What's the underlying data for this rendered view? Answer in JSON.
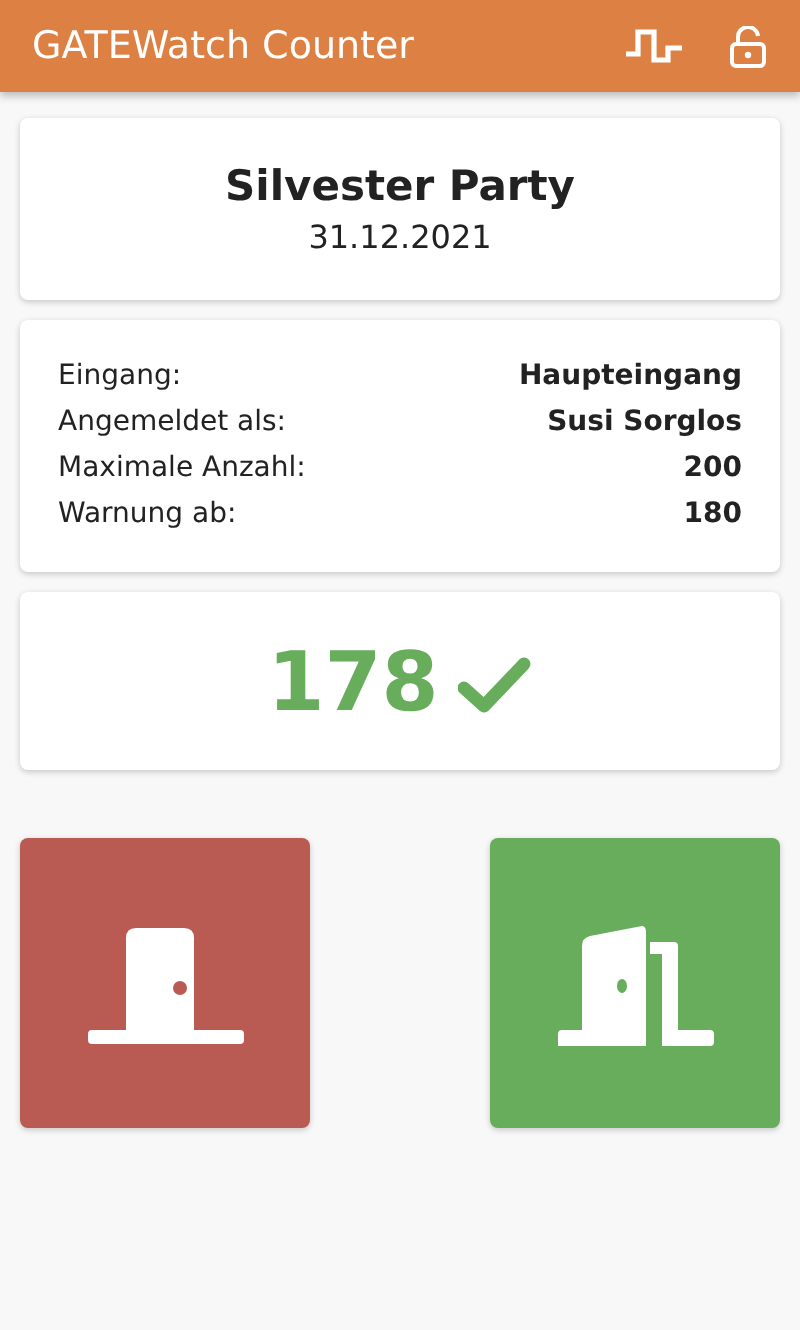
{
  "app_bar": {
    "title": "GATEWatch Counter",
    "locked": false
  },
  "event": {
    "name": "Silvester Party",
    "date": "31.12.2021"
  },
  "details": [
    {
      "label": "Eingang:",
      "value": "Haupteingang"
    },
    {
      "label": "Angemeldet als:",
      "value": "Susi Sorglos"
    },
    {
      "label": "Maximale Anzahl:",
      "value": "200"
    },
    {
      "label": "Warnung ab:",
      "value": "180"
    }
  ],
  "counter": {
    "count": "178",
    "warning": false
  },
  "actions": [
    {
      "kind": "exit"
    },
    {
      "kind": "enter"
    }
  ]
}
